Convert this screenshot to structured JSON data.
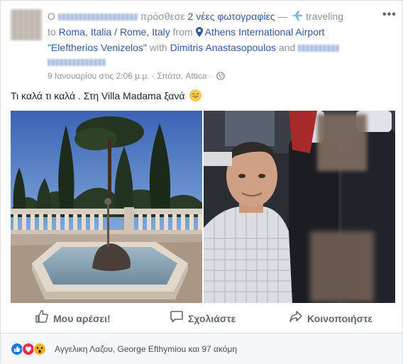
{
  "header": {
    "prefix": "Ο",
    "added_text": "πρόσθεσε",
    "photos_link": "2 νέες φωτογραφίες",
    "dash": "—",
    "activity": "traveling",
    "to_word": "to",
    "destination": "Roma, Italia / Rome, Italy",
    "from_word": "from",
    "origin": "Athens International Airport \"Eleftherios Venizelos\"",
    "with_word": "with",
    "tagged_person": "Dimitris Anastasopoulos",
    "and_word": "and",
    "more_icon": "more-options-icon"
  },
  "meta": {
    "timestamp": "9 Ιανουαρίου στις 2:06 μ.μ.",
    "separator": "·",
    "location": "Σπάτα, Attica",
    "privacy_icon": "globe-icon"
  },
  "post": {
    "text": "Τι καλά τι καλά . Στη Villa Madama ξανά"
  },
  "photos": [
    {
      "icon": "photo-villa-garden-fountain"
    },
    {
      "icon": "photo-airplane-selfie"
    }
  ],
  "actions": {
    "like": "Μου αρέσει!",
    "comment": "Σχολιάστε",
    "share": "Κοινοποιήστε"
  },
  "reactions": {
    "summary": "Αγγελικη Λαζου, George Efthymiou και 97 ακόμη",
    "icons": [
      "like-reaction-icon",
      "love-reaction-icon",
      "wow-reaction-icon"
    ]
  },
  "colors": {
    "link": "#365899",
    "secondary": "#90949c",
    "like_blue": "#1877f2",
    "love_red": "#f0284a"
  }
}
